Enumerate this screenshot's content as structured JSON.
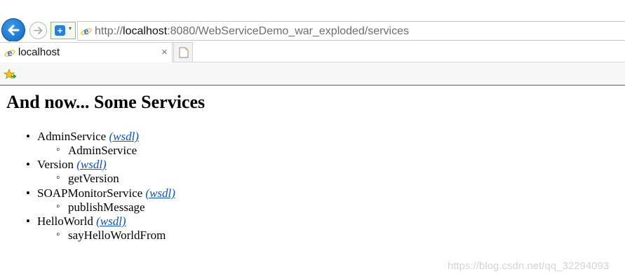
{
  "browser": {
    "address_url_prefix": "http://",
    "address_url_host": "localhost",
    "address_url_rest": ":8080/WebServiceDemo_war_exploded/services",
    "tab_title": "localhost",
    "tab_close": "×",
    "compat_symbol": "+",
    "compat_caret": "▾",
    "icons": [
      "back-arrow-icon",
      "forward-arrow-icon",
      "compatibility-view-icon",
      "internet-explorer-icon",
      "new-tab-icon",
      "favorites-star-icon"
    ],
    "colors": {
      "back_button": "#1565c0",
      "link": "#0b53b8"
    }
  },
  "page": {
    "title": "And now... Some Services",
    "services": [
      {
        "name": "AdminService",
        "wsdl": "(wsdl)",
        "operation": "AdminService"
      },
      {
        "name": "Version",
        "wsdl": "(wsdl)",
        "operation": "getVersion"
      },
      {
        "name": "SOAPMonitorService",
        "wsdl": "(wsdl)",
        "operation": "publishMessage"
      },
      {
        "name": "HelloWorld",
        "wsdl": "(wsdl)",
        "operation": "sayHelloWorldFrom"
      }
    ]
  },
  "watermark": "https://blog.csdn.net/qq_32294093"
}
